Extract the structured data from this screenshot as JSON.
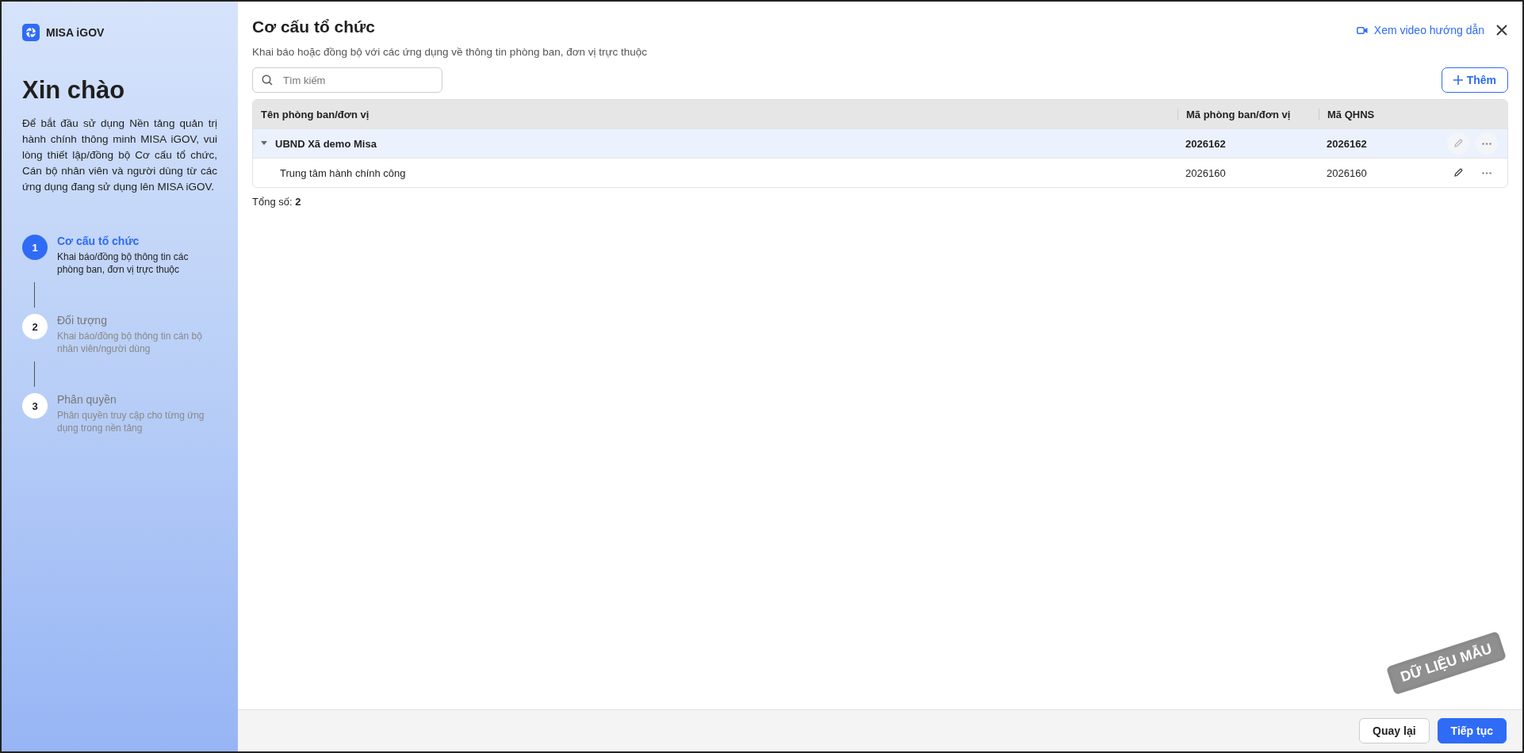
{
  "sidebar": {
    "logo_text": "MISA iGOV",
    "greeting": "Xin chào",
    "intro": "Để bắt đầu sử dụng Nền tảng quản trị hành chính thông minh MISA iGOV, vui lòng thiết lập/đồng bộ Cơ cấu tổ chức, Cán bộ nhân viên và người dùng từ các ứng dụng đang sử dụng lên MISA iGOV.",
    "steps": [
      {
        "number": "1",
        "title": "Cơ cấu tổ chức",
        "description": "Khai báo/đồng bộ thông tin các phòng ban, đơn vị trực thuộc",
        "selected": true
      },
      {
        "number": "2",
        "title": "Đối tượng",
        "description": "Khai báo/đồng bộ thông tin cán bộ nhân viên/người dùng",
        "selected": false
      },
      {
        "number": "3",
        "title": "Phân quyền",
        "description": "Phân quyền truy cập cho từng ứng dụng trong nền tảng",
        "selected": false
      }
    ]
  },
  "header": {
    "title": "Cơ cấu tổ chức",
    "subtitle": "Khai báo hoặc đồng bộ với các ứng dụng về thông tin phòng ban, đơn vị trực thuộc",
    "video_link": "Xem video hướng dẫn"
  },
  "search": {
    "placeholder": "Tìm kiếm"
  },
  "add_button": "Thêm",
  "table": {
    "columns": [
      "Tên phòng ban/đơn vị",
      "Mã phòng ban/đơn vị",
      "Mã QHNS"
    ],
    "rows": [
      {
        "name": "UBND Xã demo Misa",
        "code": "2026162",
        "qhns": "2026162",
        "selected": true,
        "expanded": true,
        "edit_disabled": true,
        "children": [
          {
            "name": "Trung tâm hành chính công",
            "code": "2026160",
            "qhns": "2026160",
            "selected": false,
            "edit_disabled": false
          }
        ]
      }
    ]
  },
  "total": {
    "label": "Tổng số:",
    "value": "2"
  },
  "stamp": "DỮ LIỆU MẪU",
  "footer": {
    "back_button": "Quay lại",
    "next_button": "Tiếp tục"
  }
}
